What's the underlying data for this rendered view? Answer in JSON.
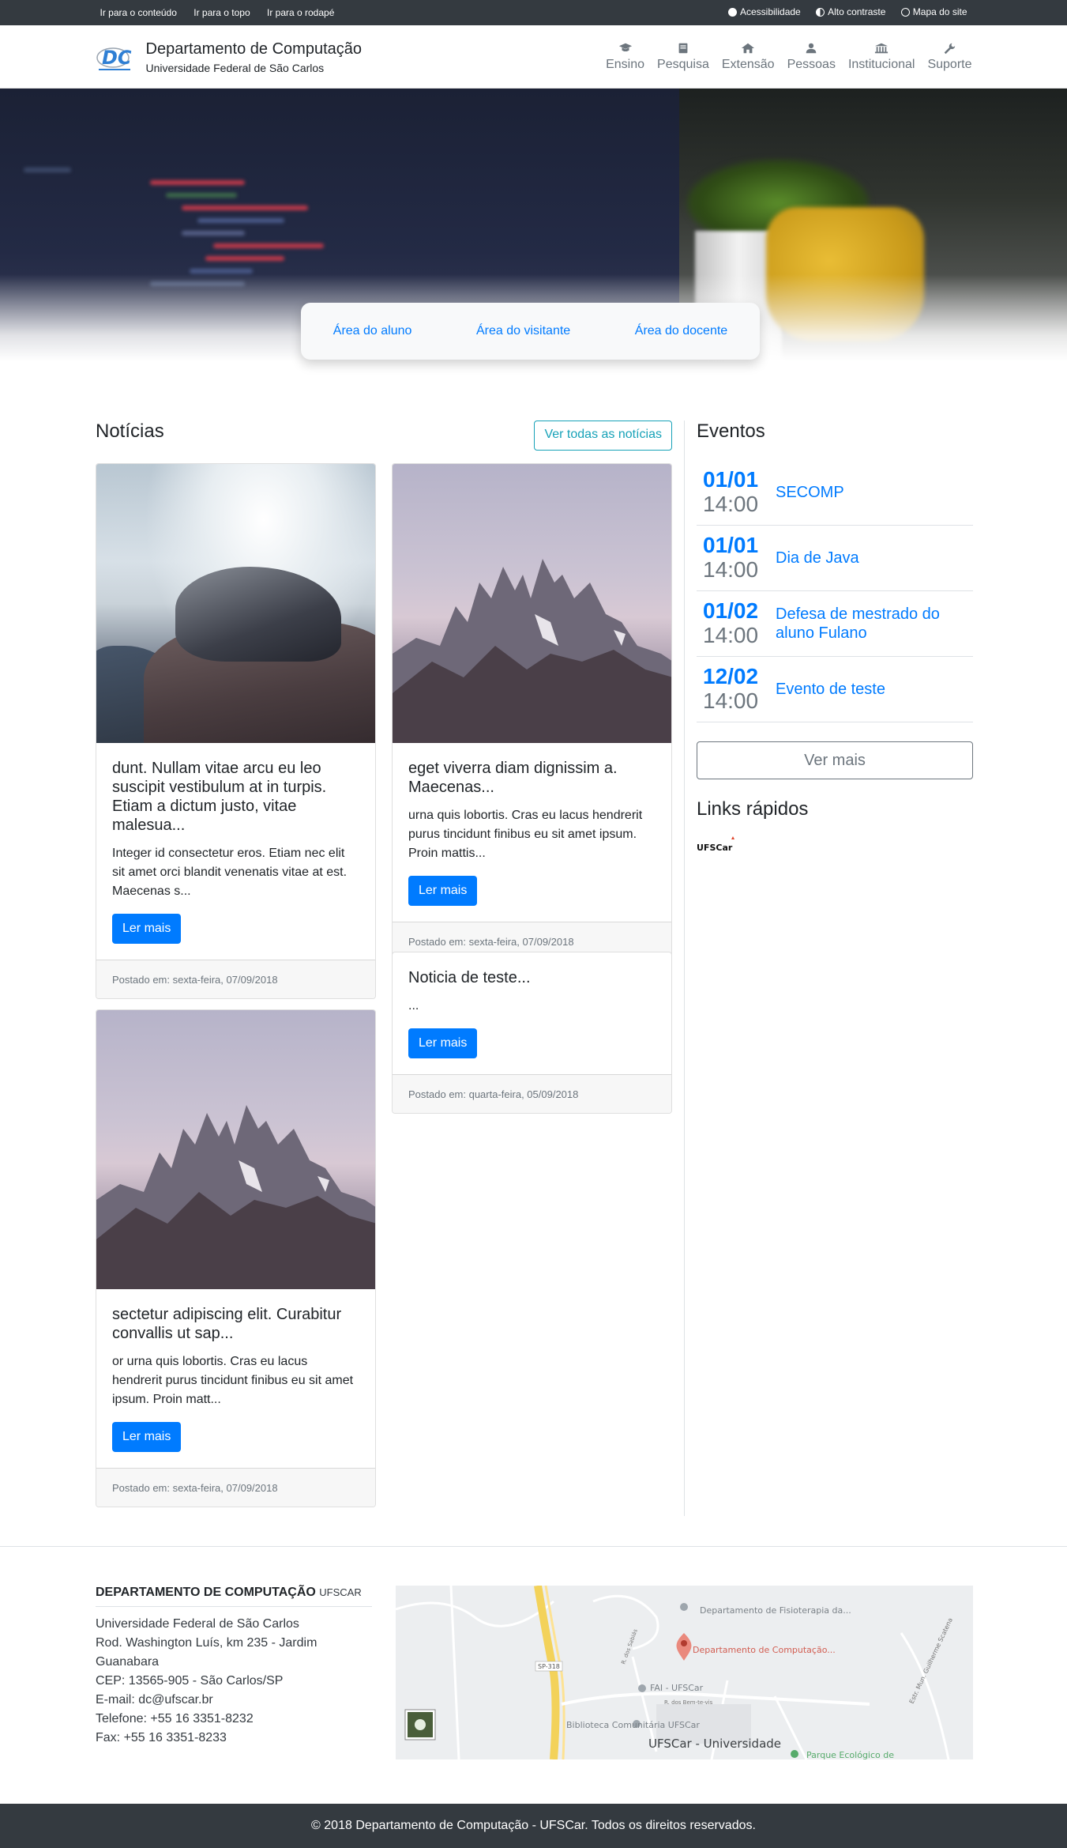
{
  "topbar": {
    "skip_content": "Ir para o conteúdo",
    "skip_top": "Ir para o topo",
    "skip_footer": "Ir para o rodapé",
    "accessibility": "Acessibilidade",
    "high_contrast": "Alto contraste",
    "sitemap": "Mapa do site"
  },
  "header": {
    "title": "Departamento de Computação",
    "subtitle": "Universidade Federal de São Carlos",
    "logo_text": "DC",
    "nav": [
      {
        "label": "Ensino",
        "icon": "graduation-cap-icon"
      },
      {
        "label": "Pesquisa",
        "icon": "book-icon"
      },
      {
        "label": "Extensão",
        "icon": "home-icon"
      },
      {
        "label": "Pessoas",
        "icon": "user-icon"
      },
      {
        "label": "Institucional",
        "icon": "institution-icon"
      },
      {
        "label": "Suporte",
        "icon": "wrench-icon"
      }
    ]
  },
  "areas": {
    "student": "Área do aluno",
    "visitor": "Área do visitante",
    "teacher": "Área do docente"
  },
  "news": {
    "title": "Notícias",
    "see_all": "Ver todas as notícias",
    "read_more": "Ler mais",
    "items": [
      {
        "title": "dunt. Nullam vitae arcu eu leo suscipit vestibulum at in turpis. Etiam a dictum justo, vitae malesua...",
        "text": "Integer id consectetur eros. Etiam nec elit sit amet orci blandit venenatis vitae at est. Maecenas s...",
        "posted": "Postado em: sexta-feira, 07/09/2018"
      },
      {
        "title": "eget viverra diam dignissim a. Maecenas...",
        "text": "urna quis lobortis. Cras eu lacus hendrerit purus tincidunt finibus eu sit amet ipsum. Proin mattis...",
        "posted": "Postado em: sexta-feira, 07/09/2018"
      },
      {
        "title": "sectetur adipiscing elit. Curabitur convallis ut sap...",
        "text": "or urna quis lobortis. Cras eu lacus hendrerit purus tincidunt finibus eu sit amet ipsum. Proin matt...",
        "posted": "Postado em: sexta-feira, 07/09/2018"
      },
      {
        "title": "Noticia de teste...",
        "text": "...",
        "posted": "Postado em: quarta-feira, 05/09/2018"
      }
    ]
  },
  "events": {
    "title": "Eventos",
    "items": [
      {
        "date": "01/01",
        "time": "14:00",
        "name": "SECOMP"
      },
      {
        "date": "01/01",
        "time": "14:00",
        "name": "Dia de Java"
      },
      {
        "date": "01/02",
        "time": "14:00",
        "name": "Defesa de mestrado do aluno Fulano"
      },
      {
        "date": "12/02",
        "time": "14:00",
        "name": "Evento de teste"
      }
    ],
    "see_more": "Ver mais"
  },
  "quick_links": {
    "title": "Links rápidos",
    "logo_text": "UFSCar"
  },
  "footer": {
    "title": "DEPARTAMENTO DE COMPUTAÇÃO",
    "title_small": "UFSCAR",
    "lines": [
      "Universidade Federal de São Carlos",
      "Rod. Washington Luís, km 235 - Jardim Guanabara",
      "CEP: 13565-905 - São Carlos/SP",
      "E-mail: dc@ufscar.br",
      "Telefone: +55 16 3351-8232",
      "Fax: +55 16 3351-8233"
    ],
    "map_labels": {
      "dept_fisio": "Departamento de Fisioterapia da...",
      "dept_comp": "Departamento de Computação...",
      "road": "SP-318",
      "fai": "FAI - UFSCar",
      "biblioteca": "Biblioteca Comunitária UFSCar",
      "ufscar": "UFSCar - Universidade",
      "parque": "Parque Ecológico de",
      "street1": "R. dos Bem-te-vis",
      "street2": "R. dos Sabiás",
      "street3": "Estr. Mun. Guilherme Scatena"
    },
    "copyright": "© 2018 Departamento de Computação - UFSCar. Todos os direitos reservados."
  },
  "colors": {
    "primary": "#007bff",
    "info": "#17a2b8",
    "dark": "#343a40",
    "muted": "#6c757d"
  }
}
